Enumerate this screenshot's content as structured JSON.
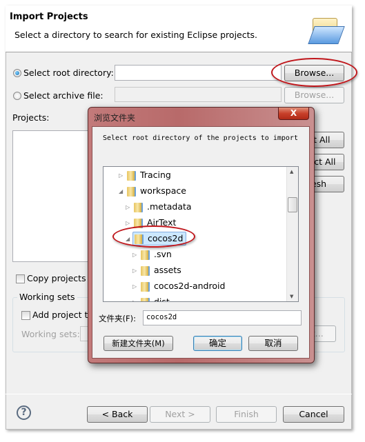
{
  "wizard": {
    "title": "Import Projects",
    "subtitle": "Select a directory to search for existing Eclipse projects.",
    "root_dir_label": "Select root directory:",
    "root_dir_value": "",
    "archive_label": "Select archive file:",
    "archive_value": "",
    "browse_label": "Browse...",
    "projects_label": "Projects:",
    "select_all": "Select All",
    "deselect_all": "Deselect All",
    "refresh": "Refresh",
    "copy_label": "Copy projects into workspace",
    "working_sets_group": "Working sets",
    "add_ws_label": "Add project to working sets",
    "ws_label": "Working sets:",
    "ws_select": "Select...",
    "back": "< Back",
    "next": "Next >",
    "finish": "Finish",
    "cancel": "Cancel",
    "help_icon": "?"
  },
  "dialog": {
    "title": "浏览文件夹",
    "close": "X",
    "description": "Select root directory of the projects to import",
    "tree": [
      {
        "label": "Tracing",
        "expanded": false
      },
      {
        "label": "workspace",
        "expanded": true
      },
      {
        "label": ".metadata",
        "expanded": false
      },
      {
        "label": "AirText",
        "expanded": false
      },
      {
        "label": "cocos2d",
        "expanded": true,
        "selected": true
      },
      {
        "label": ".svn",
        "expanded": false
      },
      {
        "label": "assets",
        "expanded": false
      },
      {
        "label": "cocos2d-android",
        "expanded": false
      },
      {
        "label": "dist",
        "expanded": false
      }
    ],
    "folder_label": "文件夹(F):",
    "folder_value": "cocos2d",
    "new_folder": "新建文件夹(M)",
    "ok": "确定",
    "cancel": "取消"
  },
  "colors": {
    "annotation": "#c0161b",
    "selection": "#cce8ff",
    "dialog_frame": "#b86a6a"
  }
}
